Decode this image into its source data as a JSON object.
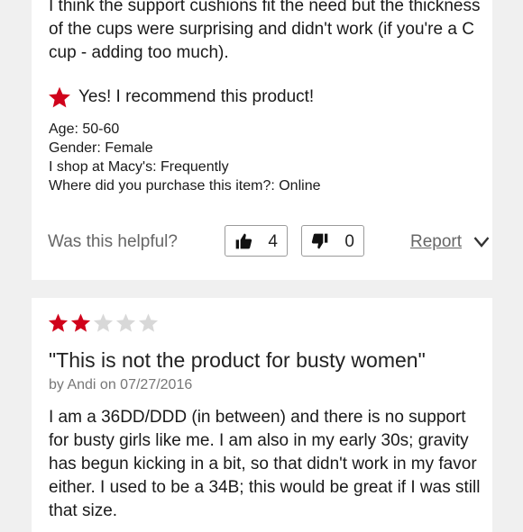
{
  "review1": {
    "body": "I think the support cushions fit the need but the thickness of the cups were surprising and didn't work (if you're a C cup - adding too much).",
    "recommend_text": "Yes! I recommend this product!",
    "attributes": [
      "Age: 50-60",
      "Gender: Female",
      "I shop at Macy's: Frequently",
      "Where did you purchase this item?: Online"
    ],
    "helpful_label": "Was this helpful?",
    "upvotes": "4",
    "downvotes": "0",
    "report_label": "Report"
  },
  "review2": {
    "rating": 2,
    "rating_max": 5,
    "title": "\"This is not the product for busty women\"",
    "byline": "by Andi on 07/27/2016",
    "body": "I am a 36DD/DDD (in between) and there is no support for busty girls like me. I am also in my early 30s; gravity has begun kicking in a bit, so that didn't work in my favor either. I used to be a 34B; this would be great if I was still that size."
  },
  "colors": {
    "star_filled": "#d0021b",
    "star_empty": "#d8d8d8",
    "muted_text": "#666666"
  },
  "icons": [
    "star-icon",
    "thumbs-up-icon",
    "thumbs-down-icon",
    "chevron-down-icon"
  ]
}
